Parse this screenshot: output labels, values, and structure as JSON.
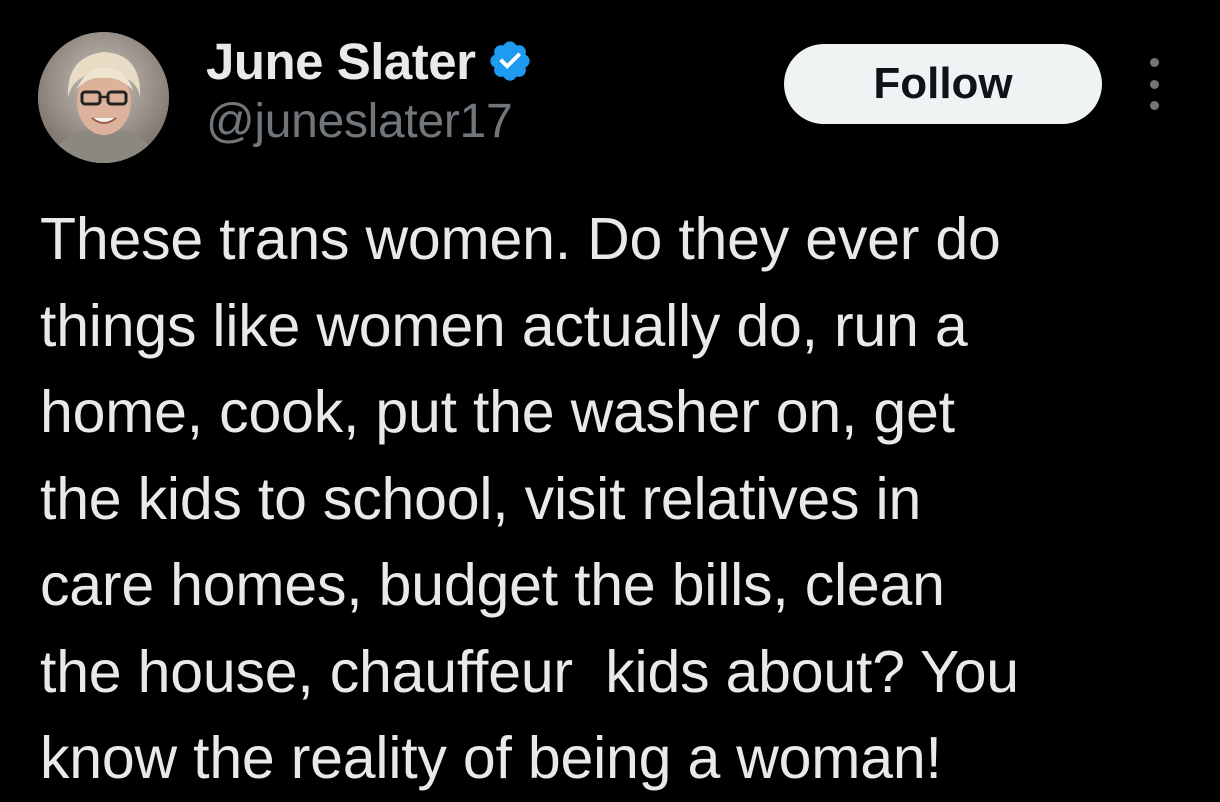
{
  "author": {
    "display_name": "June Slater",
    "handle": "@juneslater17",
    "verified": true,
    "verified_icon": "verified-badge-icon",
    "verified_color": "#1d9bf0"
  },
  "actions": {
    "follow_label": "Follow",
    "more_icon": "more-options-icon"
  },
  "tweet": {
    "lines": [
      "These trans women. Do they ever do",
      "things like women actually do, run a",
      "home, cook, put the washer on, get",
      "the kids to school, visit relatives in",
      "care homes, budget the bills, clean",
      "the house, chauffeur  kids about? You",
      "know the reality of being a woman!"
    ]
  },
  "colors": {
    "background": "#000000",
    "primary_text": "#e7e9ea",
    "secondary_text": "#71767b",
    "follow_button_bg": "#eff3f4",
    "follow_button_text": "#0f1419"
  }
}
